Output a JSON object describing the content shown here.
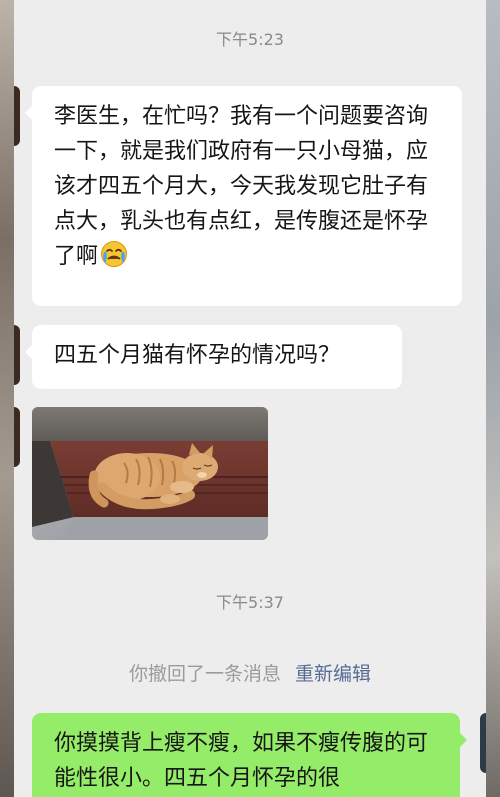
{
  "messages": {
    "time_1": "下午5:23",
    "msg_1": "李医生，在忙吗？我有一个问题要咨询一下，就是我们政府有一只小母猫，应该才四五个月大，今天我发现它肚子有点大，乳头也有点红，是传腹还是怀孕了啊",
    "msg_1_emoji": "crying-face-icon",
    "msg_2": "四五个月猫有怀孕的情况吗？",
    "photo": "cat-photo",
    "time_2": "下午5:37",
    "recall_text": "你撤回了一条消息",
    "recall_edit": "重新编辑",
    "msg_3": "你摸摸背上瘦不瘦，如果不瘦传腹的可能性很小。四五个月怀孕的很"
  },
  "colors": {
    "chat_bg": "#ededed",
    "received_bubble": "#ffffff",
    "sent_bubble": "#95ec69",
    "link": "#576b95",
    "timestamp": "#8a8a8a"
  }
}
